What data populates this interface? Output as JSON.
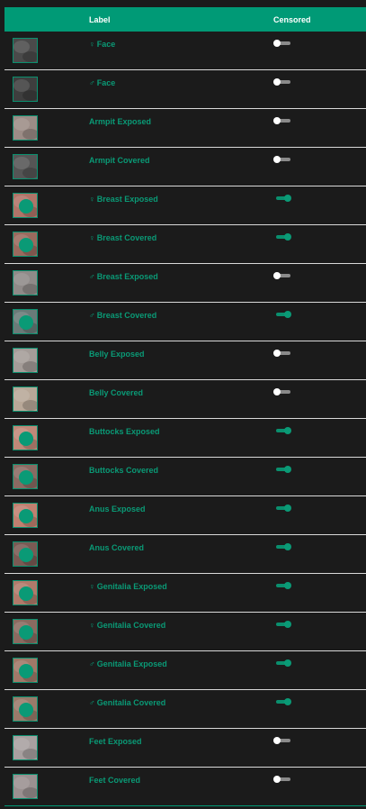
{
  "header": {
    "label": "Label",
    "censored": "Censored"
  },
  "rows": [
    {
      "symbol": "♀",
      "label": "Face",
      "censored": false,
      "thumb_color": "#4a4a4a",
      "thumb_icon": "female-face-thumbnail"
    },
    {
      "symbol": "♂",
      "label": "Face",
      "censored": false,
      "thumb_color": "#3e3e3e",
      "thumb_icon": "male-face-thumbnail"
    },
    {
      "symbol": "",
      "label": "Armpit Exposed",
      "censored": false,
      "thumb_color": "#9c8c86",
      "thumb_icon": "armpit-exposed-thumbnail"
    },
    {
      "symbol": "",
      "label": "Armpit Covered",
      "censored": false,
      "thumb_color": "#555555",
      "thumb_icon": "armpit-covered-thumbnail"
    },
    {
      "symbol": "♀",
      "label": "Breast Exposed",
      "censored": true,
      "thumb_color": "#b07468",
      "thumb_icon": "female-breast-exposed-thumbnail"
    },
    {
      "symbol": "♀",
      "label": "Breast Covered",
      "censored": true,
      "thumb_color": "#9a6a5e",
      "thumb_icon": "female-breast-covered-thumbnail"
    },
    {
      "symbol": "♂",
      "label": "Breast Exposed",
      "censored": false,
      "thumb_color": "#8f8a88",
      "thumb_icon": "male-breast-exposed-thumbnail"
    },
    {
      "symbol": "♂",
      "label": "Breast Covered",
      "censored": true,
      "thumb_color": "#6a7a78",
      "thumb_icon": "male-breast-covered-thumbnail"
    },
    {
      "symbol": "",
      "label": "Belly Exposed",
      "censored": false,
      "thumb_color": "#a49c98",
      "thumb_icon": "belly-exposed-thumbnail"
    },
    {
      "symbol": "",
      "label": "Belly Covered",
      "censored": false,
      "thumb_color": "#b8a898",
      "thumb_icon": "belly-covered-thumbnail"
    },
    {
      "symbol": "",
      "label": "Buttocks Exposed",
      "censored": true,
      "thumb_color": "#c08878",
      "thumb_icon": "buttocks-exposed-thumbnail"
    },
    {
      "symbol": "",
      "label": "Buttocks Covered",
      "censored": true,
      "thumb_color": "#8a6a62",
      "thumb_icon": "buttocks-covered-thumbnail"
    },
    {
      "symbol": "",
      "label": "Anus Exposed",
      "censored": true,
      "thumb_color": "#c08070",
      "thumb_icon": "anus-exposed-thumbnail"
    },
    {
      "symbol": "",
      "label": "Anus Covered",
      "censored": true,
      "thumb_color": "#7a5a54",
      "thumb_icon": "anus-covered-thumbnail"
    },
    {
      "symbol": "♀",
      "label": "Genitalia Exposed",
      "censored": true,
      "thumb_color": "#b07a6a",
      "thumb_icon": "female-genitalia-exposed-thumbnail"
    },
    {
      "symbol": "♀",
      "label": "Genitalia Covered",
      "censored": true,
      "thumb_color": "#8a6a60",
      "thumb_icon": "female-genitalia-covered-thumbnail"
    },
    {
      "symbol": "♂",
      "label": "Genitalia Exposed",
      "censored": true,
      "thumb_color": "#a07868",
      "thumb_icon": "male-genitalia-exposed-thumbnail"
    },
    {
      "symbol": "♂",
      "label": "Genitalia Covered",
      "censored": true,
      "thumb_color": "#9a7a6a",
      "thumb_icon": "male-genitalia-covered-thumbnail"
    },
    {
      "symbol": "",
      "label": "Feet Exposed",
      "censored": false,
      "thumb_color": "#a8a0a0",
      "thumb_icon": "feet-exposed-thumbnail"
    },
    {
      "symbol": "",
      "label": "Feet Covered",
      "censored": false,
      "thumb_color": "#9a9090",
      "thumb_icon": "feet-covered-thumbnail"
    }
  ],
  "colors": {
    "accent": "#009a76",
    "background": "#1b1b1b",
    "divider": "#d9d9d9",
    "censor_blob": "#0a9a76"
  }
}
